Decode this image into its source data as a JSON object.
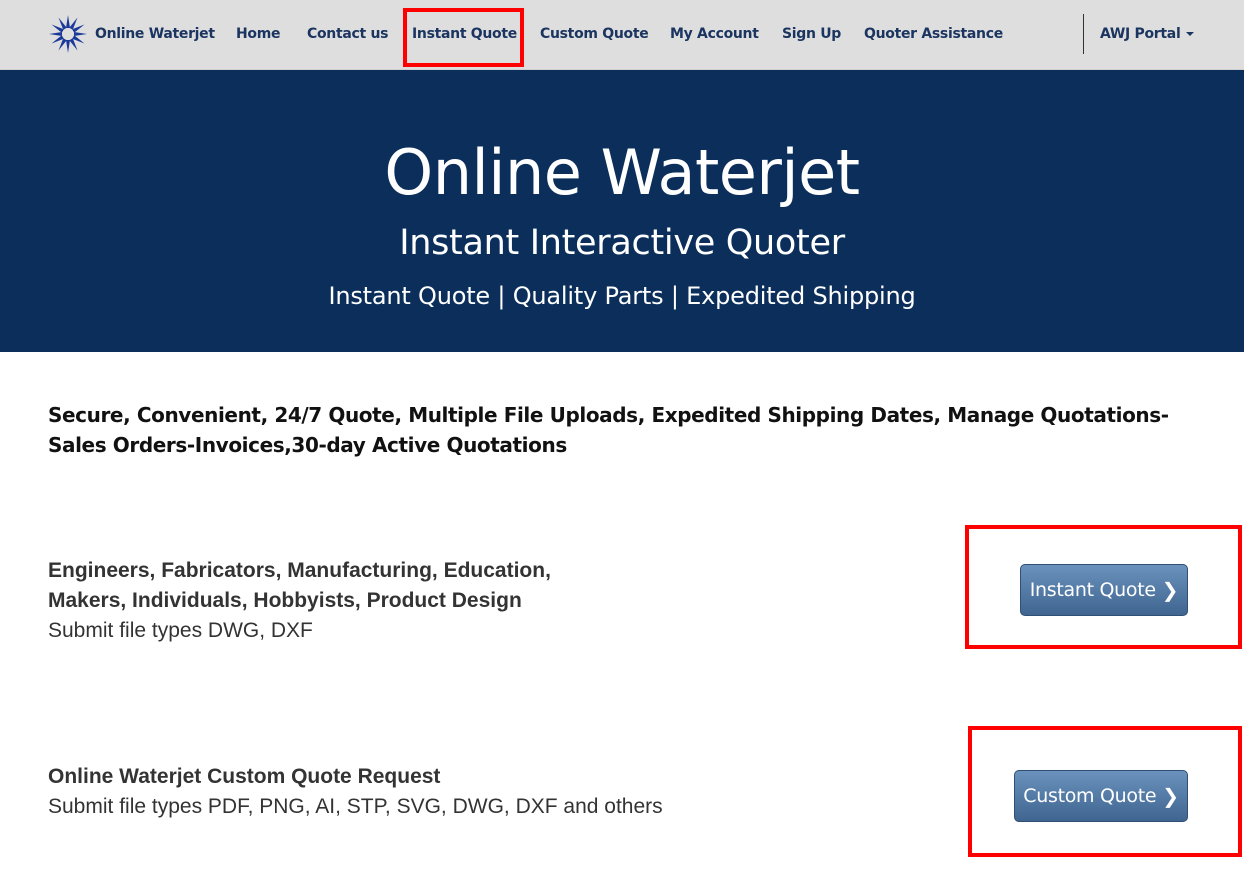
{
  "navbar": {
    "brand": {
      "icon": "starburst-logo-icon",
      "label": "Online Waterjet"
    },
    "items": [
      {
        "label": "Home"
      },
      {
        "label": "Contact us"
      },
      {
        "label": "Instant Quote",
        "highlighted": true
      },
      {
        "label": "Custom Quote"
      },
      {
        "label": "My Account"
      },
      {
        "label": "Sign Up"
      },
      {
        "label": "Quoter Assistance"
      }
    ],
    "portal_dropdown": {
      "label": "AWJ Portal",
      "icon": "caret-down-icon"
    }
  },
  "hero": {
    "title": "Online Waterjet",
    "subtitle": "Instant Interactive Quoter",
    "tagline": "Instant Quote | Quality Parts | Expedited Shipping"
  },
  "features": {
    "text": "Secure, Convenient, 24/7 Quote, Multiple File Uploads, Expedited Shipping Dates, Manage Quotations-Sales Orders-Invoices,30-day Active Quotations"
  },
  "instant_section": {
    "heading_line1": "Engineers, Fabricators, Manufacturing, Education,",
    "heading_line2": "Makers, Individuals, Hobbyists, Product Design",
    "file_types": "Submit file types  DWG, DXF",
    "button_label": "Instant Quote",
    "button_icon": "chevron-right-icon"
  },
  "custom_section": {
    "heading": "Online Waterjet Custom Quote Request",
    "file_types": "Submit file types  PDF, PNG, AI, STP, SVG, DWG, DXF and others",
    "button_label": "Custom Quote",
    "button_icon": "chevron-right-icon"
  },
  "colors": {
    "nav_bg": "#dedede",
    "nav_text": "#1b3560",
    "hero_bg": "#0b2f5a",
    "button_bg": "#4f77a3",
    "highlight": "#ff0000"
  }
}
